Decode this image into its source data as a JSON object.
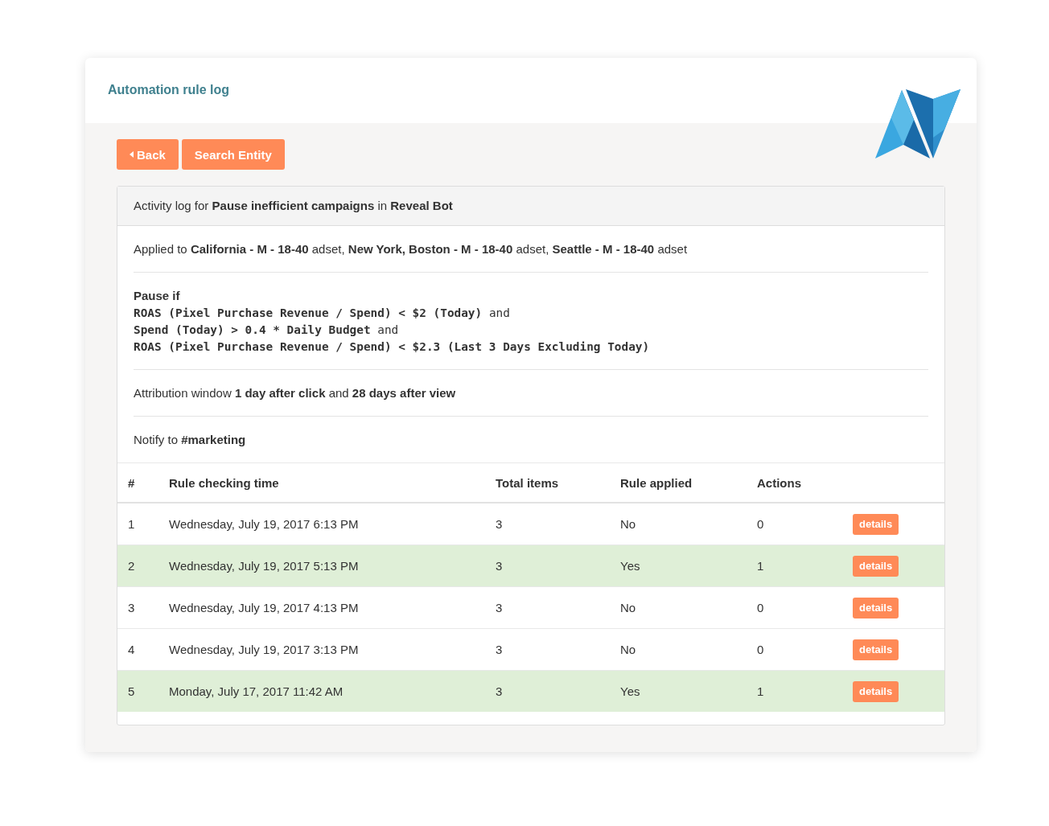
{
  "header": {
    "title": "Automation rule log"
  },
  "toolbar": {
    "buttons": [
      {
        "kind": "back",
        "label": "Back"
      },
      {
        "kind": "search",
        "label": "Search Entity"
      }
    ]
  },
  "panel": {
    "heading": "Activity log for **Pause inefficient campaigns** in **Reveal Bot**",
    "sections": [
      {
        "kind": "applied_to",
        "text": "Applied to **California - M - 18-40** adset, **New York, Boston - M - 18-40** adset, **Seattle - M - 18-40** adset"
      },
      {
        "kind": "conditions",
        "title": "Pause if",
        "conditions": [
          {
            "expression": "ROAS (Pixel Purchase Revenue / Spend) < $2 (Today)",
            "connector": "and"
          },
          {
            "expression": "Spend (Today) > 0.4 * Daily Budget",
            "connector": "and"
          },
          {
            "expression": "ROAS (Pixel Purchase Revenue / Spend) < $2.3 (Last 3 Days Excluding Today)"
          }
        ]
      },
      {
        "kind": "attribution",
        "text": "Attribution window **1 day after click** and **28 days after view**"
      },
      {
        "kind": "notify",
        "text": "Notify to **#marketing**"
      }
    ]
  },
  "table": {
    "columns": [
      "#",
      "Rule checking time",
      "Total items",
      "Rule applied",
      "Actions"
    ],
    "rows": [
      {
        "cells": [
          "1",
          "Wednesday, July 19, 2017 6:13 PM",
          "3",
          "No",
          "0"
        ],
        "highlighted": false,
        "action": "details"
      },
      {
        "cells": [
          "2",
          "Wednesday, July 19, 2017 5:13 PM",
          "3",
          "Yes",
          "1"
        ],
        "highlighted": true,
        "action": "details"
      },
      {
        "cells": [
          "3",
          "Wednesday, July 19, 2017 4:13 PM",
          "3",
          "No",
          "0"
        ],
        "highlighted": false,
        "action": "details"
      },
      {
        "cells": [
          "4",
          "Wednesday, July 19, 2017 3:13 PM",
          "3",
          "No",
          "0"
        ],
        "highlighted": false,
        "action": "details"
      },
      {
        "cells": [
          "5",
          "Monday, July 17, 2017 11:42 AM",
          "3",
          "Yes",
          "1"
        ],
        "highlighted": true,
        "action": "details"
      }
    ]
  }
}
